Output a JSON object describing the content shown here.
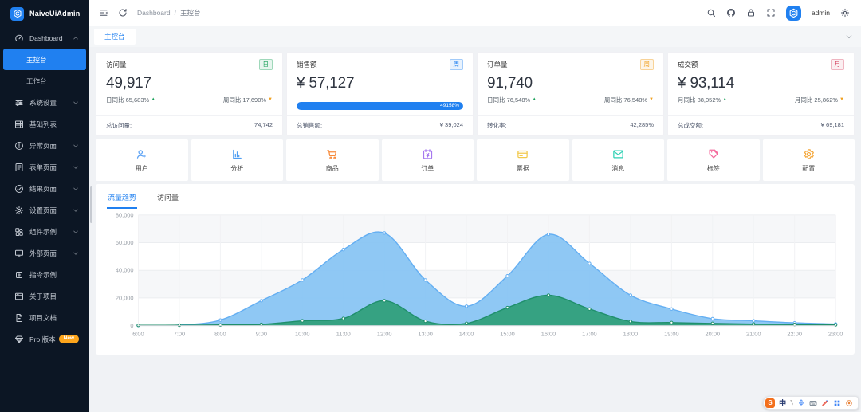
{
  "theme": {
    "primary": "#2080f0",
    "sidebar_bg": "#0c1624",
    "content_bg": "#f0f2f5",
    "success": "#18a058",
    "warning": "#f0a020",
    "error": "#d03050"
  },
  "sidebar": {
    "logo_text": "NaiveUiAdmin",
    "items": [
      {
        "label": "Dashboard",
        "icon": "dashboard-icon",
        "chevron": "up"
      },
      {
        "label": "主控台",
        "type": "child",
        "active": true
      },
      {
        "label": "工作台",
        "type": "child"
      },
      {
        "label": "系统设置",
        "icon": "sliders-icon",
        "chevron": "down"
      },
      {
        "label": "基础列表",
        "icon": "table-icon"
      },
      {
        "label": "异常页面",
        "icon": "warning-circle-icon",
        "chevron": "down"
      },
      {
        "label": "表单页面",
        "icon": "form-icon",
        "chevron": "down"
      },
      {
        "label": "结果页面",
        "icon": "check-circle-icon",
        "chevron": "down"
      },
      {
        "label": "设置页面",
        "icon": "gear-icon",
        "chevron": "down"
      },
      {
        "label": "组件示例",
        "icon": "component-icon",
        "chevron": "down"
      },
      {
        "label": "外部页面",
        "icon": "monitor-icon",
        "chevron": "down"
      },
      {
        "label": "指令示例",
        "icon": "command-icon"
      },
      {
        "label": "关于项目",
        "icon": "window-icon"
      },
      {
        "label": "项目文档",
        "icon": "document-icon"
      },
      {
        "label": "Pro 版本",
        "icon": "diamond-icon",
        "badge": "New"
      }
    ]
  },
  "header": {
    "breadcrumb": {
      "root": "Dashboard",
      "separator": "/",
      "current": "主控台"
    },
    "username": "admin"
  },
  "tabstrip": {
    "active_tab": "主控台"
  },
  "stat_cards": [
    {
      "title": "访问量",
      "badge": "日",
      "badge_color": "green",
      "value": "49,917",
      "trends": [
        {
          "label": "日同比",
          "value": "65,683%",
          "trend": "up"
        },
        {
          "label": "周同比",
          "value": "17,690%",
          "trend": "down"
        }
      ],
      "footer_label": "总访问量:",
      "footer_value": "74,742"
    },
    {
      "title": "销售额",
      "badge": "周",
      "badge_color": "blue",
      "value": "¥ 57,127",
      "progress": {
        "percent": 100,
        "label": "49158%"
      },
      "footer_label": "总销售额:",
      "footer_value": "¥ 39,024"
    },
    {
      "title": "订单量",
      "badge": "周",
      "badge_color": "orange",
      "value": "91,740",
      "trends": [
        {
          "label": "日同比",
          "value": "76,548%",
          "trend": "up"
        },
        {
          "label": "周同比",
          "value": "76,548%",
          "trend": "down"
        }
      ],
      "footer_label": "转化率:",
      "footer_value": "42,285%"
    },
    {
      "title": "成交额",
      "badge": "月",
      "badge_color": "red",
      "value": "¥ 93,114",
      "trends": [
        {
          "label": "月同比",
          "value": "88,052%",
          "trend": "up"
        },
        {
          "label": "月同比",
          "value": "25,862%",
          "trend": "down"
        }
      ],
      "footer_label": "总成交额:",
      "footer_value": "¥ 69,181"
    }
  ],
  "shortcuts": [
    {
      "label": "用户",
      "icon": "user-add-icon",
      "color": "#5ba2f5"
    },
    {
      "label": "分析",
      "icon": "bar-chart-icon",
      "color": "#4f9ef2"
    },
    {
      "label": "商品",
      "icon": "cart-icon",
      "color": "#f78b3c"
    },
    {
      "label": "订单",
      "icon": "calendar-yen-icon",
      "color": "#a678ef"
    },
    {
      "label": "票据",
      "icon": "card-icon",
      "color": "#f2c94c"
    },
    {
      "label": "消息",
      "icon": "mail-icon",
      "color": "#2fd0b4"
    },
    {
      "label": "标签",
      "icon": "tags-icon",
      "color": "#f46a9c"
    },
    {
      "label": "配置",
      "icon": "config-gear-icon",
      "color": "#f5a83c"
    }
  ],
  "chart_card": {
    "tabs": [
      {
        "label": "流量趋势",
        "active": true
      },
      {
        "label": "访问量",
        "active": false
      }
    ]
  },
  "chart_data": {
    "type": "area",
    "x": [
      "6:00",
      "7:00",
      "8:00",
      "9:00",
      "10:00",
      "11:00",
      "12:00",
      "13:00",
      "14:00",
      "15:00",
      "16:00",
      "17:00",
      "18:00",
      "19:00",
      "20:00",
      "21:00",
      "22:00",
      "23:00"
    ],
    "series": [
      {
        "color": "#63aef2",
        "fill": "#85c3f3",
        "values": [
          150,
          400,
          4000,
          18000,
          33000,
          55000,
          67000,
          33000,
          14000,
          36000,
          66000,
          45000,
          22000,
          12000,
          5000,
          3500,
          2000,
          1200
        ]
      },
      {
        "color": "#1f8f6b",
        "fill": "#2f9e77",
        "values": [
          200,
          300,
          500,
          900,
          3500,
          5200,
          18000,
          3200,
          1600,
          13000,
          22000,
          12000,
          3000,
          2200,
          1600,
          1100,
          800,
          600
        ]
      }
    ],
    "ylim": [
      0,
      80000
    ],
    "yticks": [
      0,
      20000,
      40000,
      60000,
      80000
    ],
    "grid": true,
    "legend": "none",
    "title": "",
    "xlabel": "",
    "ylabel": ""
  },
  "ime": {
    "logo": "S",
    "mode": "中",
    "punct": "’,"
  }
}
